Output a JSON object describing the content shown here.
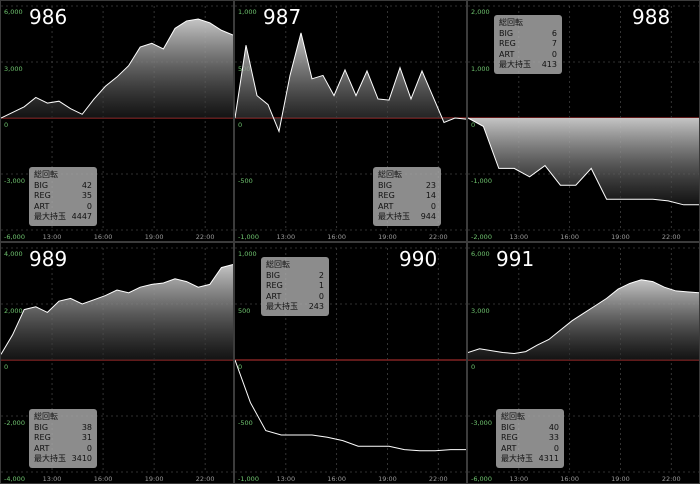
{
  "colors": {
    "grid": "#404040",
    "zero_line": "#c23434",
    "y_tick": "#6fc46f",
    "x_tick": "#9a9a9a",
    "line": "#ffffff",
    "fill_top": "#cfcfcf",
    "fill_bottom": "#202020"
  },
  "x_ticks": [
    "13:00",
    "16:00",
    "19:00",
    "22:00"
  ],
  "chart_data": [
    {
      "type": "area",
      "title": "986",
      "ylim": [
        -6000,
        6000
      ],
      "yticks": [
        "6,000",
        "3,000",
        "0",
        "-3,000",
        "-6,000"
      ],
      "x": [
        0,
        1,
        2,
        3,
        4,
        5,
        6,
        7,
        8,
        9,
        10,
        11,
        12,
        13,
        14,
        15,
        16,
        17,
        18,
        19,
        20
      ],
      "values": [
        0,
        300,
        600,
        1100,
        800,
        900,
        500,
        200,
        1000,
        1700,
        2200,
        2800,
        3800,
        4000,
        3700,
        4800,
        5200,
        5300,
        5100,
        4700,
        4447
      ],
      "stats": {
        "title": "総回転",
        "rows": [
          [
            "BIG",
            "42"
          ],
          [
            "REG",
            "35"
          ],
          [
            "ART",
            "0"
          ],
          [
            "最大持玉",
            "4447"
          ]
        ]
      }
    },
    {
      "type": "area",
      "title": "987",
      "ylim": [
        -1000,
        1000
      ],
      "yticks": [
        "1,000",
        "500",
        "0",
        "-500",
        "-1,000"
      ],
      "x": [
        0,
        1,
        2,
        3,
        4,
        5,
        6,
        7,
        8,
        9,
        10,
        11,
        12,
        13,
        14,
        15,
        16,
        17,
        18,
        19,
        20,
        21
      ],
      "values": [
        0,
        650,
        200,
        120,
        -120,
        380,
        760,
        350,
        380,
        200,
        430,
        200,
        420,
        170,
        160,
        450,
        170,
        420,
        190,
        -40,
        0,
        -10
      ],
      "stats": {
        "title": "総回転",
        "rows": [
          [
            "BIG",
            "23"
          ],
          [
            "REG",
            "14"
          ],
          [
            "ART",
            "0"
          ],
          [
            "最大持玉",
            "944"
          ]
        ]
      }
    },
    {
      "type": "area",
      "title": "988",
      "ylim": [
        -2000,
        2000
      ],
      "yticks": [
        "2,000",
        "1,000",
        "0",
        "-1,000",
        "-2,000"
      ],
      "x": [
        0,
        1,
        2,
        3,
        4,
        5,
        6,
        7,
        8,
        9,
        10,
        11,
        12,
        13,
        14,
        15
      ],
      "values": [
        0,
        -150,
        -900,
        -900,
        -1050,
        -850,
        -1200,
        -1200,
        -900,
        -1450,
        -1450,
        -1450,
        -1450,
        -1480,
        -1550,
        -1550
      ],
      "stats": {
        "title": "総回転",
        "rows": [
          [
            "BIG",
            "6"
          ],
          [
            "REG",
            "7"
          ],
          [
            "ART",
            "0"
          ],
          [
            "最大持玉",
            "413"
          ]
        ]
      }
    },
    {
      "type": "area",
      "title": "989",
      "ylim": [
        -4000,
        4000
      ],
      "yticks": [
        "4,000",
        "2,000",
        "0",
        "-2,000",
        "-4,000"
      ],
      "x": [
        0,
        1,
        2,
        3,
        4,
        5,
        6,
        7,
        8,
        9,
        10,
        11,
        12,
        13,
        14,
        15,
        16,
        17,
        18,
        19,
        20
      ],
      "values": [
        200,
        900,
        1800,
        1900,
        1700,
        2100,
        2200,
        2000,
        2150,
        2300,
        2500,
        2400,
        2600,
        2700,
        2750,
        2900,
        2800,
        2600,
        2700,
        3300,
        3410
      ],
      "stats": {
        "title": "総回転",
        "rows": [
          [
            "BIG",
            "38"
          ],
          [
            "REG",
            "31"
          ],
          [
            "ART",
            "0"
          ],
          [
            "最大持玉",
            "3410"
          ]
        ]
      }
    },
    {
      "type": "line",
      "title": "990",
      "ylim": [
        -1000,
        1000
      ],
      "yticks": [
        "1,000",
        "500",
        "0",
        "-500",
        "-1,000"
      ],
      "x": [
        0,
        1,
        2,
        3,
        4,
        5,
        6,
        7,
        8,
        9,
        10,
        11,
        12,
        13,
        14,
        15
      ],
      "values": [
        0,
        -380,
        -630,
        -670,
        -670,
        -670,
        -690,
        -720,
        -770,
        -770,
        -770,
        -800,
        -810,
        -810,
        -800,
        -800
      ],
      "stats": {
        "title": "総回転",
        "rows": [
          [
            "BIG",
            "2"
          ],
          [
            "REG",
            "1"
          ],
          [
            "ART",
            "0"
          ],
          [
            "最大持玉",
            "243"
          ]
        ]
      }
    },
    {
      "type": "area",
      "title": "991",
      "ylim": [
        -6000,
        6000
      ],
      "yticks": [
        "6,000",
        "3,000",
        "0",
        "-3,000",
        "-6,000"
      ],
      "x": [
        0,
        1,
        2,
        3,
        4,
        5,
        6,
        7,
        8,
        9,
        10,
        11,
        12,
        13,
        14,
        15,
        16,
        17,
        18,
        19,
        20
      ],
      "values": [
        400,
        600,
        500,
        400,
        350,
        450,
        800,
        1100,
        1600,
        2100,
        2500,
        2900,
        3300,
        3800,
        4100,
        4300,
        4200,
        3900,
        3700,
        3650,
        3600
      ],
      "stats": {
        "title": "総回転",
        "rows": [
          [
            "BIG",
            "40"
          ],
          [
            "REG",
            "33"
          ],
          [
            "ART",
            "0"
          ],
          [
            "最大持玉",
            "4311"
          ]
        ]
      }
    }
  ]
}
